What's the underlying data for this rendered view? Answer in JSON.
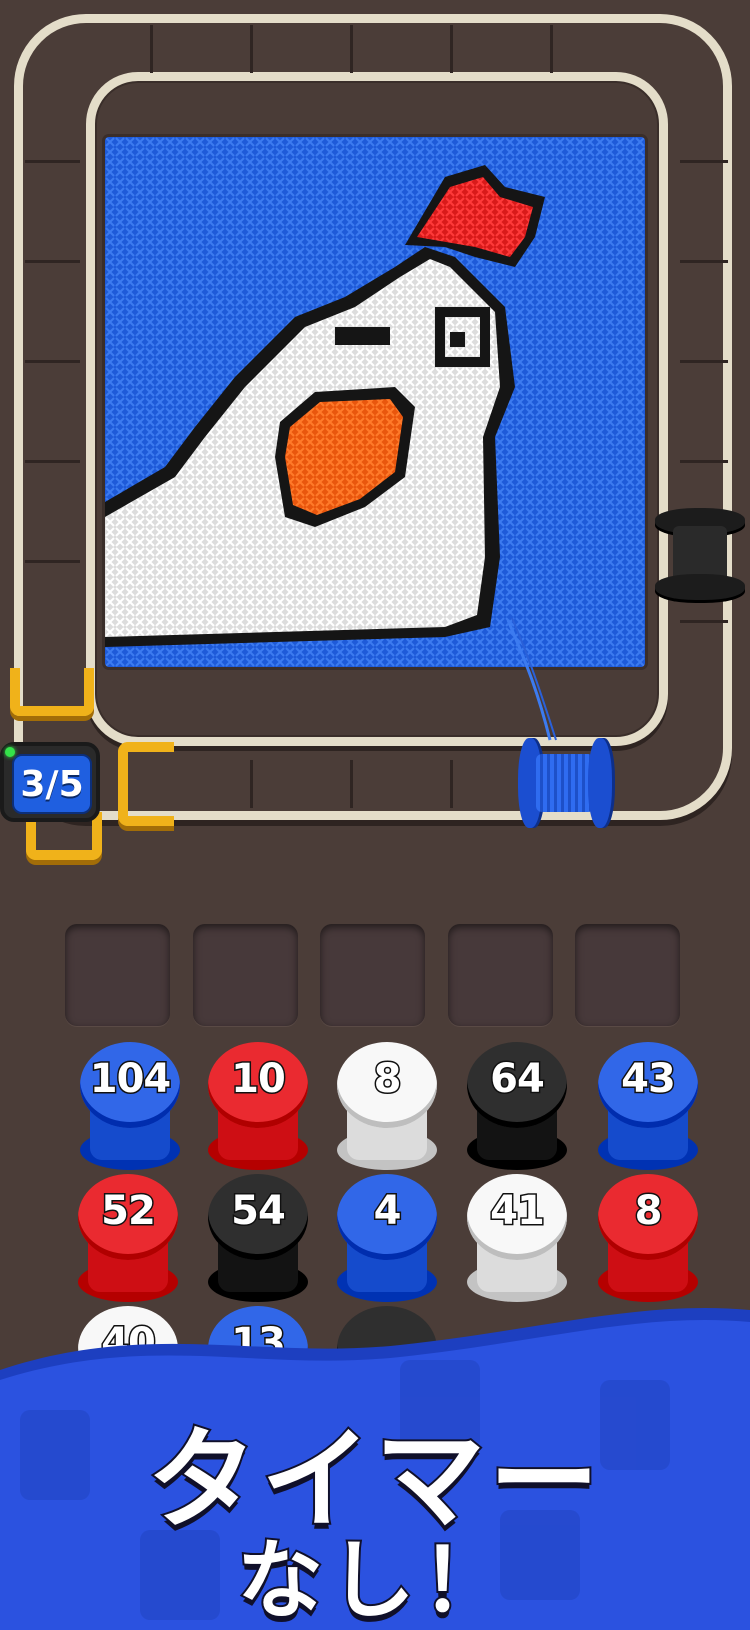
{
  "progress": {
    "label": "3/5",
    "current": 3,
    "total": 5
  },
  "spools": [
    {
      "count": "104",
      "color": "blue"
    },
    {
      "count": "10",
      "color": "red"
    },
    {
      "count": "8",
      "color": "white"
    },
    {
      "count": "64",
      "color": "black"
    },
    {
      "count": "43",
      "color": "blue"
    },
    {
      "count": "52",
      "color": "red"
    },
    {
      "count": "54",
      "color": "black"
    },
    {
      "count": "4",
      "color": "blue"
    },
    {
      "count": "41",
      "color": "white"
    },
    {
      "count": "8",
      "color": "red"
    },
    {
      "count": "40",
      "color": "white"
    },
    {
      "count": "13",
      "color": "blue"
    }
  ],
  "slots_empty": 5,
  "colors": {
    "blue": "#1f55d6",
    "red": "#d8181e",
    "white": "#e6e6e6",
    "black": "#1d1d1d",
    "background": "#4b3d38",
    "banner": "#2a4fd8"
  },
  "banner": {
    "line1": "タイマー",
    "line2": "なし！"
  }
}
